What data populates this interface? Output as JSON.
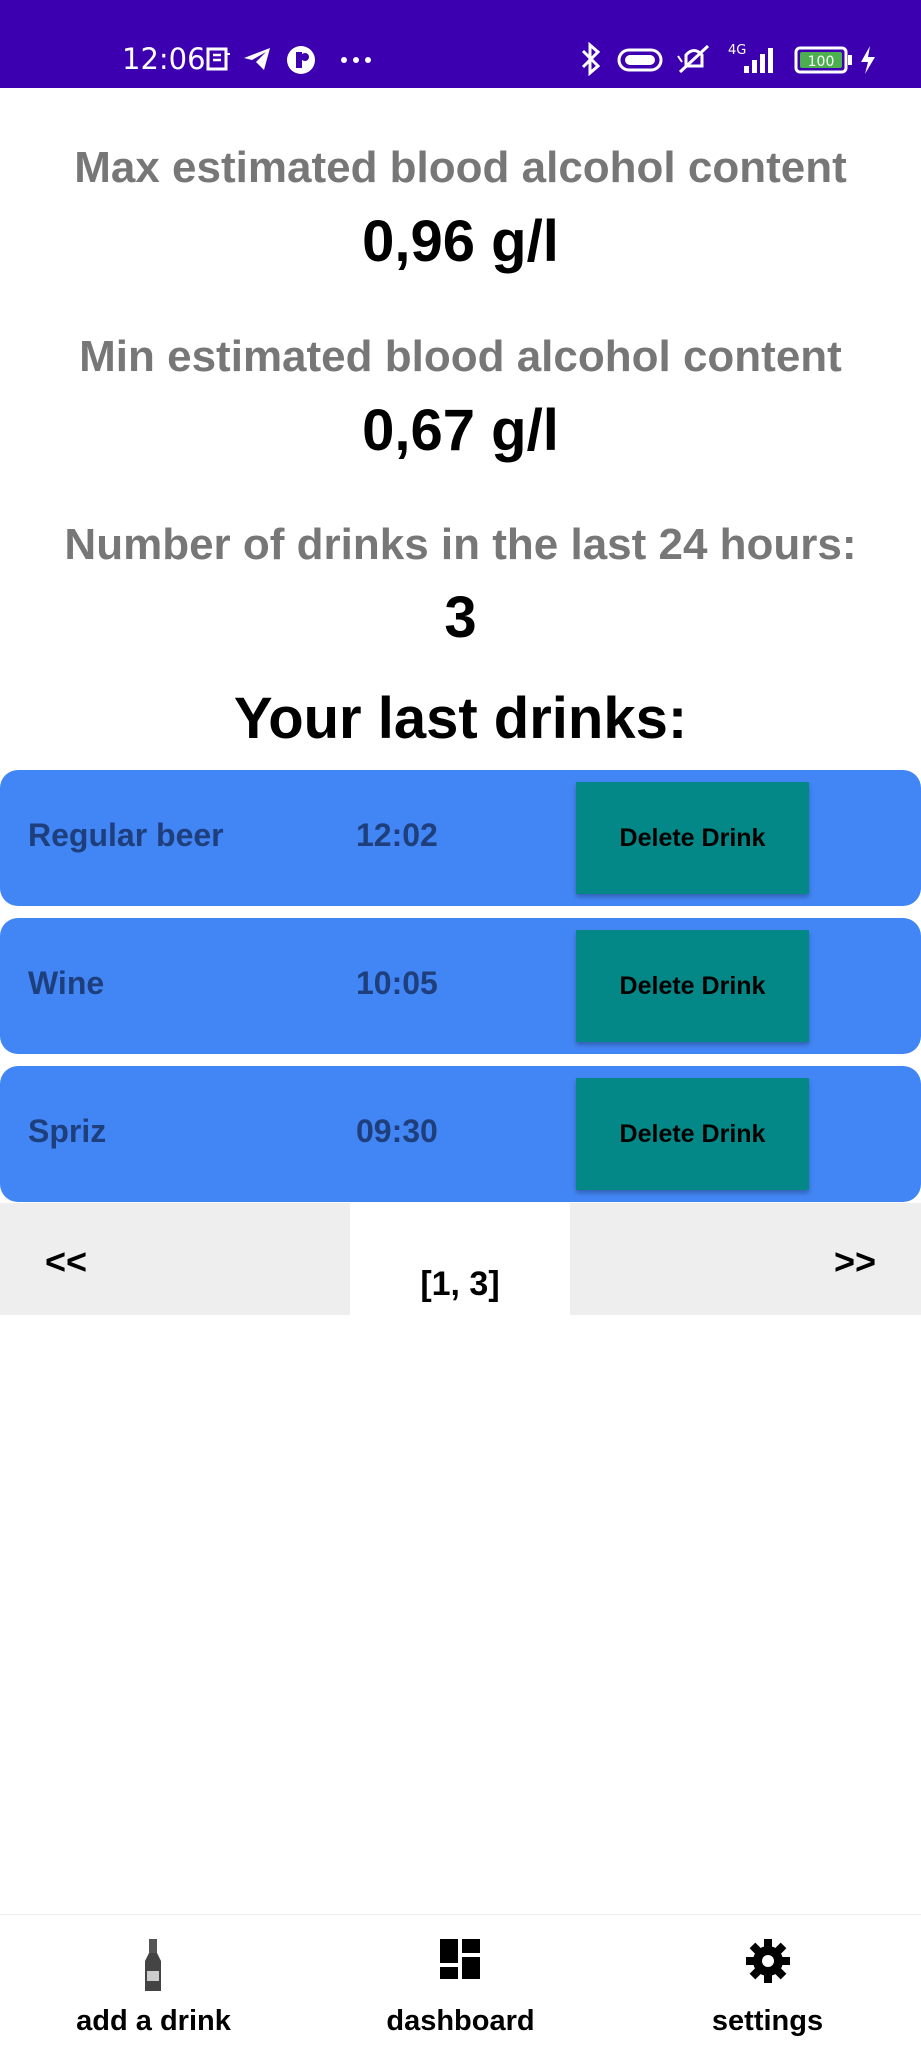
{
  "status_bar": {
    "time": "12:06",
    "battery": "100",
    "network": "4G"
  },
  "stats": {
    "max_label": "Max estimated blood alcohol content",
    "max_value": "0,96 g/l",
    "min_label": "Min estimated blood alcohol content",
    "min_value": "0,67 g/l",
    "count_label": "Number of drinks in the last 24 hours:",
    "count_value": "3"
  },
  "last_drinks_title": "Your last drinks:",
  "drinks": [
    {
      "name": "Regular beer",
      "time": "12:02",
      "delete_label": "Delete Drink"
    },
    {
      "name": "Wine",
      "time": "10:05",
      "delete_label": "Delete Drink"
    },
    {
      "name": "Spriz",
      "time": "09:30",
      "delete_label": "Delete Drink"
    }
  ],
  "pager": {
    "prev_label": "<<",
    "next_label": ">>",
    "indicator": "[1, 3]"
  },
  "bottom_nav": {
    "items": [
      {
        "label": "add a drink",
        "icon": "bottle-icon"
      },
      {
        "label": "dashboard",
        "icon": "dashboard-icon"
      },
      {
        "label": "settings",
        "icon": "gear-icon"
      }
    ]
  },
  "colors": {
    "status_bar": "#3d00b0",
    "row_bg": "#4285f4",
    "delete_button": "#038787",
    "pager_bg": "#eeeeee",
    "label_gray": "#777777"
  }
}
